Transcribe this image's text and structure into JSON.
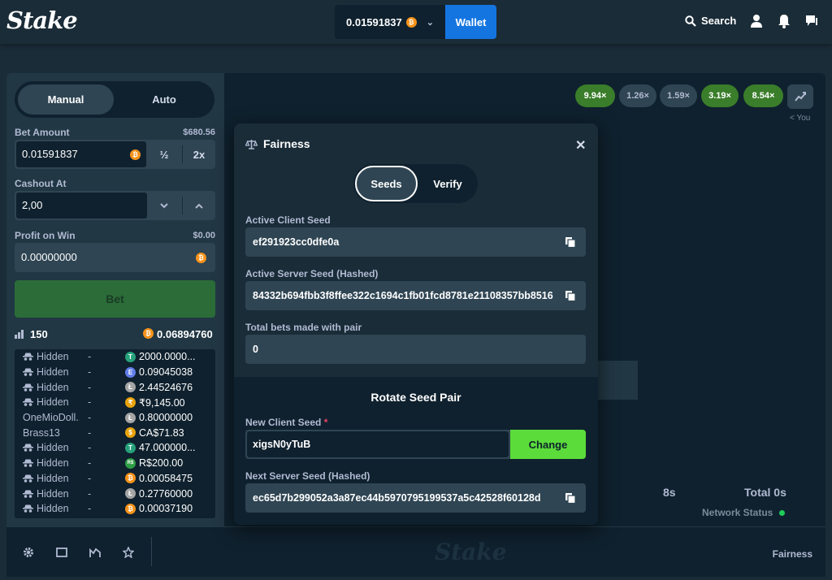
{
  "header": {
    "logo": "Stake",
    "balance": "0.01591837",
    "currency_icon": "bitcoin-icon",
    "wallet_label": "Wallet",
    "search_label": "Search"
  },
  "controls": {
    "mode_manual": "Manual",
    "mode_auto": "Auto",
    "bet_amount_label": "Bet Amount",
    "bet_amount_usd": "$680.56",
    "bet_amount_value": "0.01591837",
    "half_label": "½",
    "double_label": "2x",
    "cashout_label": "Cashout At",
    "cashout_value": "2,00",
    "profit_label": "Profit on Win",
    "profit_usd": "$0.00",
    "profit_value": "0.00000000",
    "bet_button": "Bet",
    "players_count": "150",
    "total_wagered": "0.06894760"
  },
  "bets": [
    {
      "user": "Hidden",
      "hidden": true,
      "cashout": "-",
      "amount": "2000.0000...",
      "token": "T",
      "token_color": "#26a17b"
    },
    {
      "user": "Hidden",
      "hidden": true,
      "cashout": "-",
      "amount": "0.09045038",
      "token": "E",
      "token_color": "#627eea"
    },
    {
      "user": "Hidden",
      "hidden": true,
      "cashout": "-",
      "amount": "2.44524676",
      "token": "Ł",
      "token_color": "#a5a5a5"
    },
    {
      "user": "Hidden",
      "hidden": true,
      "cashout": "-",
      "amount": "₹9,145.00",
      "token": "₹",
      "token_color": "#e8a30c"
    },
    {
      "user": "OneMioDoll...",
      "hidden": false,
      "cashout": "-",
      "amount": "0.80000000",
      "token": "Ł",
      "token_color": "#a5a5a5"
    },
    {
      "user": "Brass13",
      "hidden": false,
      "cashout": "-",
      "amount": "CA$71.83",
      "token": "$",
      "token_color": "#e8a30c"
    },
    {
      "user": "Hidden",
      "hidden": true,
      "cashout": "-",
      "amount": "47.000000...",
      "token": "T",
      "token_color": "#26a17b"
    },
    {
      "user": "Hidden",
      "hidden": true,
      "cashout": "-",
      "amount": "R$200.00",
      "token": "R$",
      "token_color": "#2e9e44"
    },
    {
      "user": "Hidden",
      "hidden": true,
      "cashout": "-",
      "amount": "0.00058475",
      "token": "₿",
      "token_color": "#f7931a"
    },
    {
      "user": "Hidden",
      "hidden": true,
      "cashout": "-",
      "amount": "0.27760000",
      "token": "Ł",
      "token_color": "#a5a5a5"
    },
    {
      "user": "Hidden",
      "hidden": true,
      "cashout": "-",
      "amount": "0.00037190",
      "token": "₿",
      "token_color": "#f7931a"
    }
  ],
  "history": [
    {
      "value": "9.94×",
      "status": "green"
    },
    {
      "value": "1.26×",
      "status": "grey"
    },
    {
      "value": "1.59×",
      "status": "grey"
    },
    {
      "value": "3.19×",
      "status": "green"
    },
    {
      "value": "8.54×",
      "status": "green"
    }
  ],
  "game": {
    "you_label": "< You",
    "timer": "8s",
    "total": "Total 0s",
    "network_status": "Network Status"
  },
  "footer": {
    "logo": "Stake",
    "fairness": "Fairness"
  },
  "modal": {
    "title": "Fairness",
    "tab_seeds": "Seeds",
    "tab_verify": "Verify",
    "client_seed_label": "Active Client Seed",
    "client_seed": "ef291923cc0dfe0a",
    "server_seed_label": "Active Server Seed (Hashed)",
    "server_seed": "84332b694fbb3f8ffee322c1694c1fb01fcd8781e21108357bb8516",
    "total_bets_label": "Total bets made with pair",
    "total_bets": "0",
    "rotate_title": "Rotate Seed Pair",
    "new_client_seed_label": "New Client Seed",
    "required_mark": "*",
    "new_client_seed": "xigsN0yTuB",
    "change_button": "Change",
    "next_server_seed_label": "Next Server Seed (Hashed)",
    "next_server_seed": "ec65d7b299052a3a87ec44b5970795199537a5c42528f60128d"
  }
}
